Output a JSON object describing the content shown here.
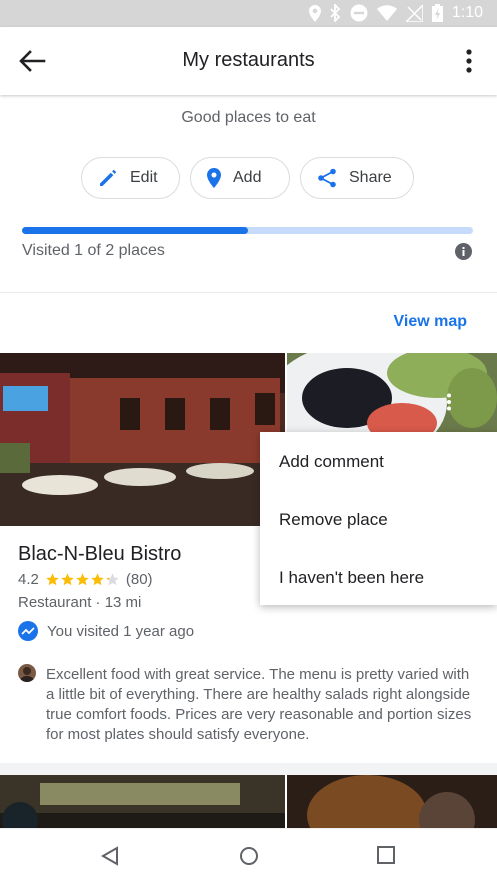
{
  "status_bar": {
    "time": "1:10"
  },
  "app_bar": {
    "title": "My restaurants",
    "back_icon": "arrow-back-icon",
    "more_icon": "more-vert-icon"
  },
  "list": {
    "subtitle": "Good places to eat",
    "actions": [
      {
        "label": "Edit",
        "icon": "pencil-icon"
      },
      {
        "label": "Add",
        "icon": "map-pin-icon"
      },
      {
        "label": "Share",
        "icon": "share-icon"
      }
    ],
    "progress": {
      "visited": 1,
      "total": 2,
      "fraction": 0.5,
      "label": "Visited 1 of 2 places"
    },
    "view_map_label": "View map"
  },
  "place": {
    "name": "Blac-N-Bleu Bistro",
    "rating": "4.2",
    "rating_value": 4.2,
    "reviews": "(80)",
    "category": "Restaurant · 13 mi",
    "visited": "You visited 1 year ago",
    "review": "Excellent food with great service. The menu is pretty varied with a little bit of everything. There are healthy salads right alongside true comfort foods. Prices are very reasonable and portion sizes for most plates should satisfy everyone."
  },
  "menu": {
    "items": [
      "Add comment",
      "Remove place",
      "I haven't been here"
    ]
  },
  "colors": {
    "accent": "#1a73e8",
    "star": "#fbbc04",
    "progress_track": "#c6dafc"
  }
}
